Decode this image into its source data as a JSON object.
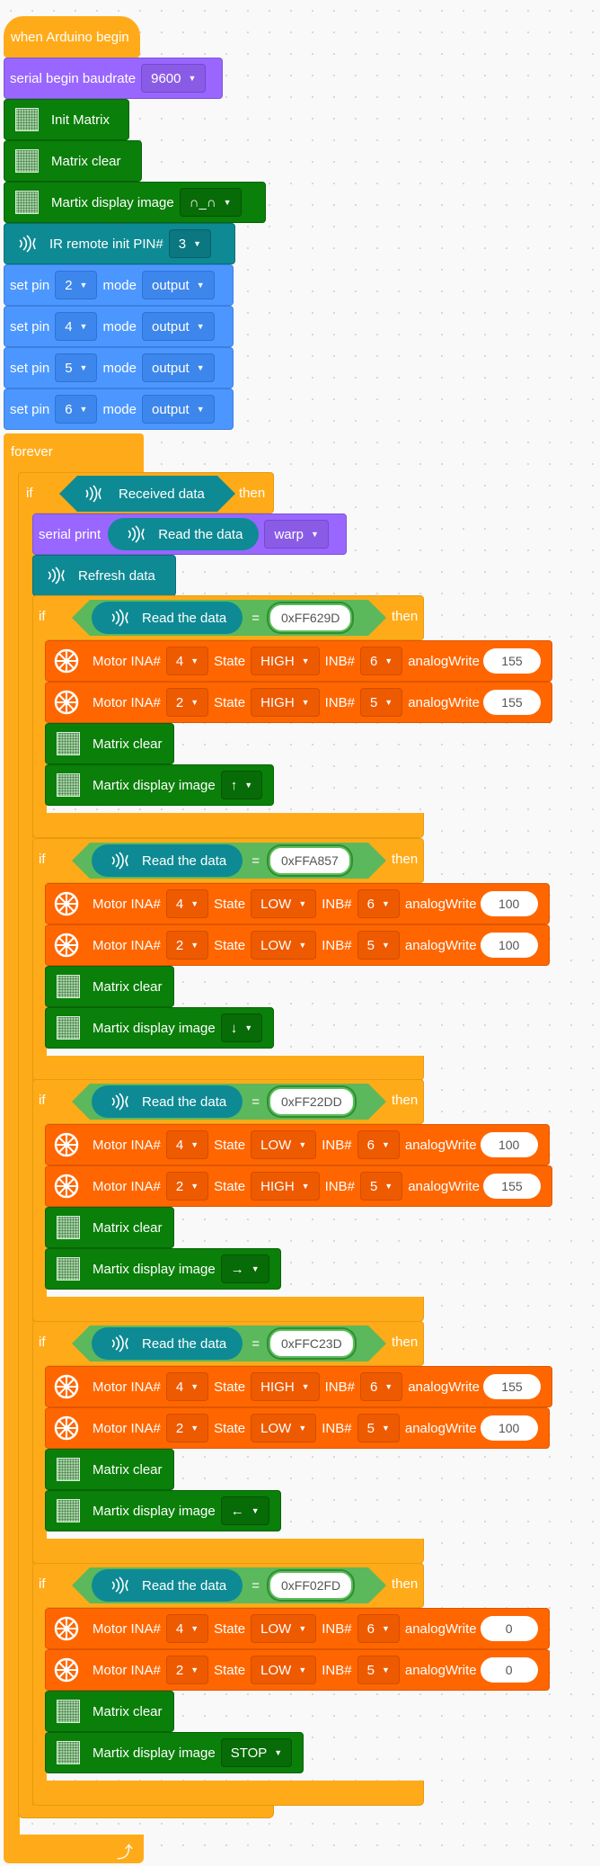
{
  "hat": {
    "label": "when Arduino begin"
  },
  "setup": {
    "serial_begin": {
      "label": "serial begin baudrate",
      "value": "9600"
    },
    "init_matrix": {
      "label": "Init Matrix"
    },
    "matrix_clear": {
      "label": "Matrix clear"
    },
    "display_image": {
      "label": "Martix display image",
      "value": "∩_∩"
    },
    "ir_init": {
      "label": "IR remote init PIN#",
      "value": "3"
    },
    "set_pins": [
      {
        "label": "set pin",
        "pin": "2",
        "mode_label": "mode",
        "mode": "output"
      },
      {
        "label": "set pin",
        "pin": "4",
        "mode_label": "mode",
        "mode": "output"
      },
      {
        "label": "set pin",
        "pin": "5",
        "mode_label": "mode",
        "mode": "output"
      },
      {
        "label": "set pin",
        "pin": "6",
        "mode_label": "mode",
        "mode": "output"
      }
    ]
  },
  "forever": {
    "label": "forever"
  },
  "outer_if": {
    "if_label": "if",
    "then_label": "then",
    "condition": "Received data",
    "serial_print": {
      "label": "serial print",
      "read": "Read the data",
      "format": "warp"
    },
    "refresh": {
      "label": "Refresh data"
    }
  },
  "cases": [
    {
      "if_label": "if",
      "read": "Read the data",
      "eq": "=",
      "code": "0xFF629D",
      "then_label": "then",
      "motors": [
        {
          "label": "Motor INA#",
          "ina": "4",
          "state_label": "State",
          "state": "HIGH",
          "inb_label": "INB#",
          "inb": "6",
          "aw_label": "analogWrite",
          "aw": "155"
        },
        {
          "label": "Motor INA#",
          "ina": "2",
          "state_label": "State",
          "state": "HIGH",
          "inb_label": "INB#",
          "inb": "5",
          "aw_label": "analogWrite",
          "aw": "155"
        }
      ],
      "clear": "Matrix clear",
      "display": "Martix display image",
      "image": "↑"
    },
    {
      "if_label": "if",
      "read": "Read the data",
      "eq": "=",
      "code": "0xFFA857",
      "then_label": "then",
      "motors": [
        {
          "label": "Motor INA#",
          "ina": "4",
          "state_label": "State",
          "state": "LOW",
          "inb_label": "INB#",
          "inb": "6",
          "aw_label": "analogWrite",
          "aw": "100"
        },
        {
          "label": "Motor INA#",
          "ina": "2",
          "state_label": "State",
          "state": "LOW",
          "inb_label": "INB#",
          "inb": "5",
          "aw_label": "analogWrite",
          "aw": "100"
        }
      ],
      "clear": "Matrix clear",
      "display": "Martix display image",
      "image": "↓"
    },
    {
      "if_label": "if",
      "read": "Read the data",
      "eq": "=",
      "code": "0xFF22DD",
      "then_label": "then",
      "motors": [
        {
          "label": "Motor INA#",
          "ina": "4",
          "state_label": "State",
          "state": "LOW",
          "inb_label": "INB#",
          "inb": "6",
          "aw_label": "analogWrite",
          "aw": "100"
        },
        {
          "label": "Motor INA#",
          "ina": "2",
          "state_label": "State",
          "state": "HIGH",
          "inb_label": "INB#",
          "inb": "5",
          "aw_label": "analogWrite",
          "aw": "155"
        }
      ],
      "clear": "Matrix clear",
      "display": "Martix display image",
      "image": "→"
    },
    {
      "if_label": "if",
      "read": "Read the data",
      "eq": "=",
      "code": "0xFFC23D",
      "then_label": "then",
      "motors": [
        {
          "label": "Motor INA#",
          "ina": "4",
          "state_label": "State",
          "state": "HIGH",
          "inb_label": "INB#",
          "inb": "6",
          "aw_label": "analogWrite",
          "aw": "155"
        },
        {
          "label": "Motor INA#",
          "ina": "2",
          "state_label": "State",
          "state": "LOW",
          "inb_label": "INB#",
          "inb": "5",
          "aw_label": "analogWrite",
          "aw": "100"
        }
      ],
      "clear": "Matrix clear",
      "display": "Martix display image",
      "image": "←"
    },
    {
      "if_label": "if",
      "read": "Read the data",
      "eq": "=",
      "code": "0xFF02FD",
      "then_label": "then",
      "motors": [
        {
          "label": "Motor INA#",
          "ina": "4",
          "state_label": "State",
          "state": "LOW",
          "inb_label": "INB#",
          "inb": "6",
          "aw_label": "analogWrite",
          "aw": "0"
        },
        {
          "label": "Motor INA#",
          "ina": "2",
          "state_label": "State",
          "state": "LOW",
          "inb_label": "INB#",
          "inb": "5",
          "aw_label": "analogWrite",
          "aw": "0"
        }
      ],
      "clear": "Matrix clear",
      "display": "Martix display image",
      "image": "STOP"
    }
  ],
  "loop_arrow": {
    "icon": "loop-arrow-icon"
  },
  "colors": {
    "control": "#ffab19",
    "serial": "#9966ff",
    "matrix": "#0a7f0a",
    "ir": "#0e8a94",
    "pin": "#4c97ff",
    "motor": "#ff6600",
    "operator": "#5cb85c"
  }
}
